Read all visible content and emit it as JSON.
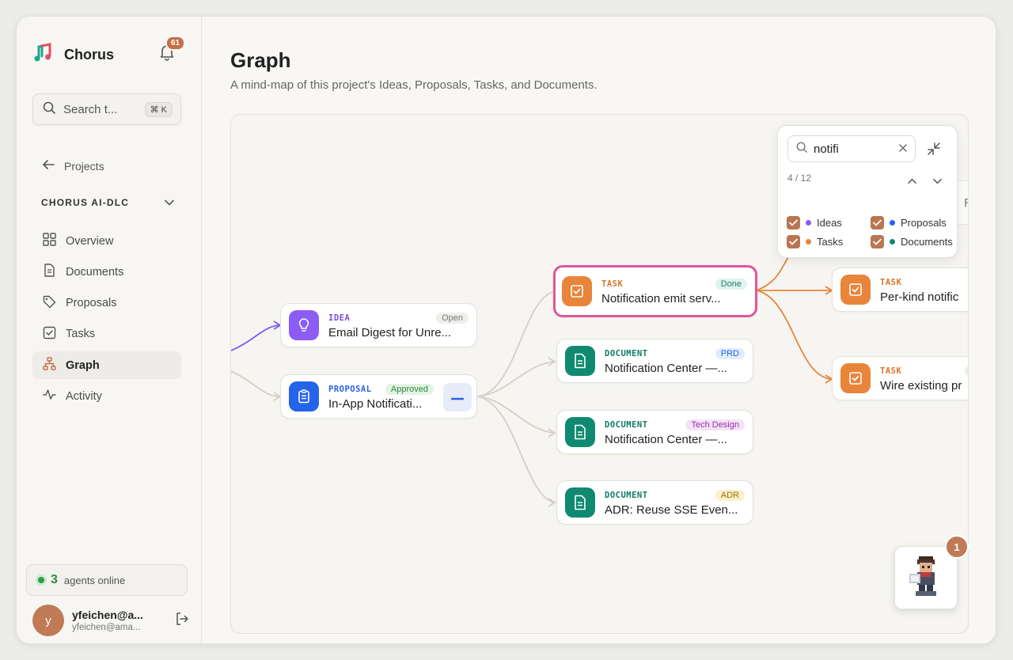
{
  "sidebar": {
    "brand_name": "Chorus",
    "notification_count": "61",
    "search_placeholder": "Search t...",
    "search_shortcut": "⌘ K",
    "back_label": "Projects",
    "project_name": "CHORUS AI-DLC",
    "nav": [
      {
        "label": "Overview",
        "icon": "grid-icon"
      },
      {
        "label": "Documents",
        "icon": "document-icon"
      },
      {
        "label": "Proposals",
        "icon": "tag-icon"
      },
      {
        "label": "Tasks",
        "icon": "checkbox-icon"
      },
      {
        "label": "Graph",
        "icon": "graph-icon",
        "active": true
      },
      {
        "label": "Activity",
        "icon": "activity-icon"
      }
    ],
    "agents_count": "3",
    "agents_label": "agents online",
    "user_name": "yfeichen@a...",
    "user_email": "yfeichen@ama...",
    "user_initial": "y"
  },
  "main": {
    "title": "Graph",
    "subtitle": "A mind-map of this project's Ideas, Proposals, Tasks, and Documents."
  },
  "graph": {
    "nodes": [
      {
        "kind": "IDEA",
        "status": "Open",
        "title": "Email Digest for Unre...",
        "icon": "lightbulb-icon"
      },
      {
        "kind": "PROPOSAL",
        "status": "Approved",
        "title": "In-App Notificati...",
        "icon": "clipboard-icon"
      },
      {
        "kind": "TASK",
        "status": "Done",
        "title": "Notification emit serv...",
        "icon": "check-square-icon"
      },
      {
        "kind": "DOCUMENT",
        "status": "PRD",
        "title": "Notification Center —...",
        "icon": "document-icon"
      },
      {
        "kind": "DOCUMENT",
        "status": "Tech Design",
        "title": "Notification Center —...",
        "icon": "document-icon"
      },
      {
        "kind": "DOCUMENT",
        "status": "ADR",
        "title": "ADR: Reuse SSE Even...",
        "icon": "document-icon"
      },
      {
        "kind": "TASK",
        "status": "",
        "title": "Per-kind notific",
        "icon": "check-square-icon"
      },
      {
        "kind": "TASK",
        "status": "In",
        "title": "Wire existing pr",
        "icon": "check-square-icon"
      }
    ],
    "partial_label": "RE"
  },
  "find": {
    "query": "notifi",
    "count": "4 / 12",
    "filters": [
      {
        "label": "Ideas",
        "color": "#8b5cf6"
      },
      {
        "label": "Proposals",
        "color": "#2563eb"
      },
      {
        "label": "Tasks",
        "color": "#e8853a"
      },
      {
        "label": "Documents",
        "color": "#0f8a70"
      }
    ]
  },
  "bot": {
    "badge": "1"
  },
  "colors": {
    "idea": "#8b5cf6",
    "proposal": "#2563eb",
    "task": "#e8853a",
    "document": "#0f8a70",
    "selected_border": "#e0569a",
    "accent": "#c07a55"
  }
}
